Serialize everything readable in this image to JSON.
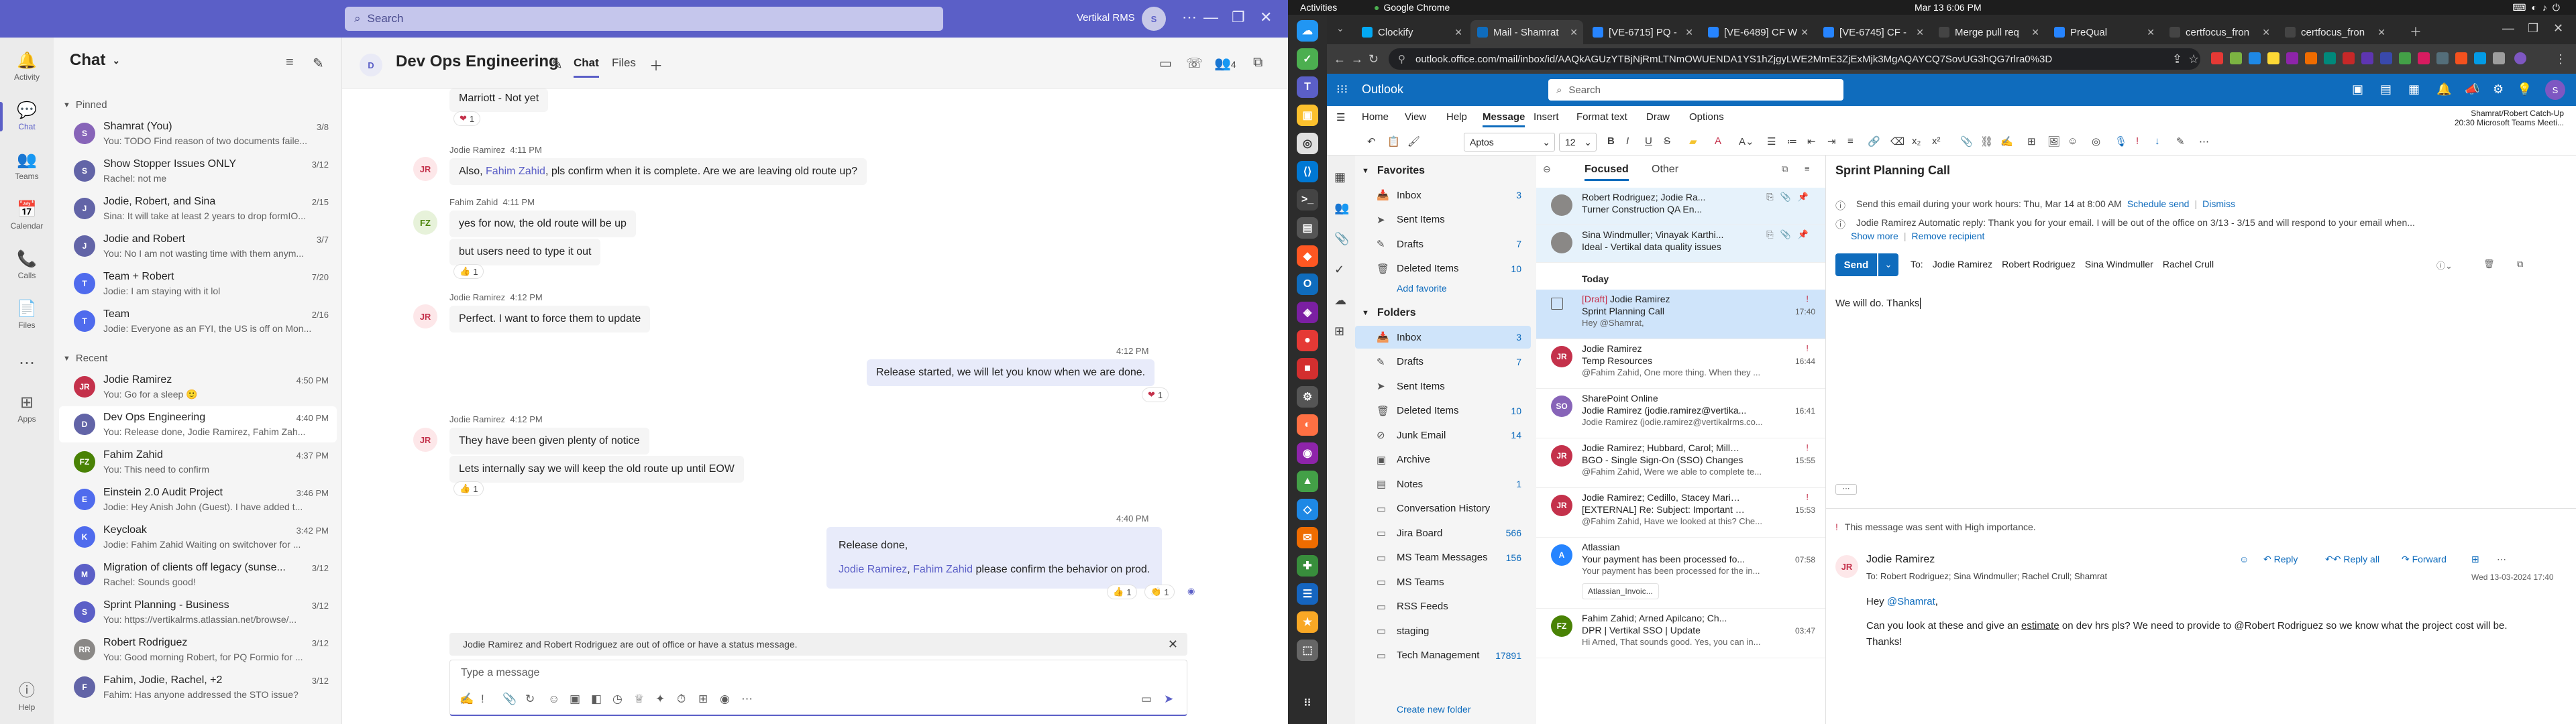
{
  "teams": {
    "search_placeholder": "Search",
    "org_name": "Vertikal RMS",
    "avatar_initials": "S",
    "rail": [
      {
        "label": "Activity",
        "icon": "bell-icon"
      },
      {
        "label": "Chat",
        "icon": "chat-icon"
      },
      {
        "label": "Teams",
        "icon": "teams-icon"
      },
      {
        "label": "Calendar",
        "icon": "calendar-icon"
      },
      {
        "label": "Calls",
        "icon": "phone-icon"
      },
      {
        "label": "Files",
        "icon": "file-icon"
      },
      {
        "label": "Apps",
        "icon": "apps-icon"
      },
      {
        "label": "Help",
        "icon": "help-icon"
      }
    ],
    "list_title": "Chat",
    "pinned_label": "Pinned",
    "recent_label": "Recent",
    "pinned": [
      {
        "name": "Shamrat (You)",
        "preview": "You: TODO Find reason of two documents faile...",
        "date": "3/8",
        "initials": "S",
        "color": "#8764b8"
      },
      {
        "name": "Show Stopper Issues ONLY",
        "preview": "Rachel: not me",
        "date": "3/12",
        "initials": "S",
        "color": "#6264a7"
      },
      {
        "name": "Jodie, Robert, and Sina",
        "preview": "Sina: It will take at least 2 years to drop formIO...",
        "date": "2/15",
        "initials": "J",
        "color": "#6264a7"
      },
      {
        "name": "Jodie and Robert",
        "preview": "You: No I am not wasting time with them anym...",
        "date": "3/7",
        "initials": "J",
        "color": "#6264a7"
      },
      {
        "name": "Team + Robert",
        "preview": "Jodie: I am staying with it lol",
        "date": "7/20",
        "initials": "T",
        "color": "#4f6bed"
      },
      {
        "name": "Team",
        "preview": "Jodie: Everyone as an FYI, the US is off on Mon...",
        "date": "2/16",
        "initials": "T",
        "color": "#4f6bed"
      }
    ],
    "recent": [
      {
        "name": "Jodie Ramirez",
        "preview": "You: Go for a sleep 🙂",
        "date": "4:50 PM",
        "initials": "JR",
        "color": "#c4314b"
      },
      {
        "name": "Dev Ops Engineering",
        "preview": "You: Release done, Jodie Ramirez, Fahim Zah...",
        "date": "4:40 PM",
        "initials": "D",
        "color": "#6264a7"
      },
      {
        "name": "Fahim Zahid",
        "preview": "You: This need to confirm",
        "date": "4:37 PM",
        "initials": "FZ",
        "color": "#498205"
      },
      {
        "name": "Einstein 2.0 Audit Project",
        "preview": "Jodie: Hey Anish John (Guest). I have added t...",
        "date": "3:46 PM",
        "initials": "E",
        "color": "#4f6bed"
      },
      {
        "name": "Keycloak",
        "preview": "Jodie: Fahim Zahid Waiting on switchover for ...",
        "date": "3:42 PM",
        "initials": "K",
        "color": "#4f6bed"
      },
      {
        "name": "Migration of clients off legacy (sunse...",
        "preview": "Rachel: Sounds good!",
        "date": "3/12",
        "initials": "M",
        "color": "#5b5fc7"
      },
      {
        "name": "Sprint Planning - Business",
        "preview": "You: https://vertikalrms.atlassian.net/browse/...",
        "date": "3/12",
        "initials": "S",
        "color": "#5b5fc7"
      },
      {
        "name": "Robert Rodriguez",
        "preview": "You: Good morning Robert, for PQ Formio for ...",
        "date": "3/12",
        "initials": "RR",
        "color": "#8a8886"
      },
      {
        "name": "Fahim, Jodie, Rachel, +2",
        "preview": "Fahim: Has anyone addressed the STO issue?",
        "date": "3/12",
        "initials": "F",
        "color": "#6264a7"
      }
    ],
    "chat": {
      "title": "Dev Ops Engineering",
      "tab_chat": "Chat",
      "tab_files": "Files",
      "participants": "4",
      "messages": [
        {
          "text": "Marriott - Not yet",
          "reaction": "1"
        },
        {
          "author": "Jodie Ramirez",
          "time": "4:11 PM",
          "text_before": "Also, ",
          "mention": "Fahim Zahid",
          "text_after": ", pls confirm when it is complete.  Are we are leaving old route up?"
        },
        {
          "author": "Fahim Zahid",
          "time": "4:11 PM",
          "text1": "yes for now, the old route will be up",
          "text2": "but users need to type it out",
          "reaction": "1"
        },
        {
          "author": "Jodie Ramirez",
          "time": "4:12 PM",
          "text": "Perfect.  I want to force them to update"
        },
        {
          "me_time": "4:12 PM",
          "text": "Release started, we will let you know when we are done.",
          "reaction": "1"
        },
        {
          "author": "Jodie Ramirez",
          "time": "4:12 PM",
          "text1": "They have been given plenty of notice",
          "text2": "Lets internally say we will keep the old route up until EOW",
          "reaction": "1"
        },
        {
          "me_time": "4:40 PM",
          "line1": "Release done,",
          "mention1": "Jodie Ramirez",
          "sep": ", ",
          "mention2": "Fahim Zahid",
          "line2_after": " please confirm the behavior on prod.",
          "reaction_a": "1",
          "reaction_b": "1"
        }
      ],
      "ooo_notice": "Jodie Ramirez and Robert Rodriguez are out of office or have a status message.",
      "compose_placeholder": "Type a message"
    }
  },
  "os": {
    "activities": "Activities",
    "app_name": "Google Chrome",
    "clock": "Mar 13  6:06 PM"
  },
  "chrome": {
    "tabs": [
      {
        "title": "Clockify",
        "color": "#03a9f4"
      },
      {
        "title": "Mail - Shamrat",
        "color": "#0f6cbd",
        "active": true
      },
      {
        "title": "[VE-6715] PQ -",
        "color": "#2684ff"
      },
      {
        "title": "[VE-6489] CF W",
        "color": "#2684ff"
      },
      {
        "title": "[VE-6745] CF -",
        "color": "#2684ff"
      },
      {
        "title": "Merge pull req",
        "color": "#444"
      },
      {
        "title": "PreQual",
        "color": "#2684ff"
      },
      {
        "title": "certfocus_fron",
        "color": "#444"
      },
      {
        "title": "certfocus_fron",
        "color": "#444"
      }
    ],
    "url": "outlook.office.com/mail/inbox/id/AAQkAGUzYTBjNjRmLTNmOWUENDA1YS1hZjgyLWE2MmE3ZjExMjk3MgAQAYCQ7SovUG3hQG7rlra0%3D"
  },
  "outlook": {
    "brand": "Outlook",
    "search_placeholder": "Search",
    "avatar": "S",
    "ribbon_tabs": [
      "Home",
      "View",
      "Help",
      "Message",
      "Insert",
      "Format text",
      "Draw",
      "Options"
    ],
    "meeting": {
      "title": "Shamrat/Robert Catch-Up",
      "sub": "20:30 Microsoft Teams Meeti..."
    },
    "font_name": "Aptos",
    "font_size": "12",
    "favorites_label": "Favorites",
    "favorites": [
      {
        "name": "Inbox",
        "count": "3",
        "icon": "inbox-icon"
      },
      {
        "name": "Sent Items",
        "count": "",
        "icon": "send-icon"
      },
      {
        "name": "Drafts",
        "count": "7",
        "icon": "draft-icon"
      },
      {
        "name": "Deleted Items",
        "count": "10",
        "icon": "trash-icon"
      }
    ],
    "add_favorite": "Add favorite",
    "folders_label": "Folders",
    "folders": [
      {
        "name": "Inbox",
        "count": "3",
        "icon": "inbox-icon",
        "selected": true
      },
      {
        "name": "Drafts",
        "count": "7",
        "icon": "draft-icon"
      },
      {
        "name": "Sent Items",
        "count": "",
        "icon": "send-icon"
      },
      {
        "name": "Deleted Items",
        "count": "10",
        "icon": "trash-icon"
      },
      {
        "name": "Junk Email",
        "count": "14",
        "icon": "junk-icon"
      },
      {
        "name": "Archive",
        "count": "",
        "icon": "archive-icon"
      },
      {
        "name": "Notes",
        "count": "1",
        "icon": "note-icon"
      },
      {
        "name": "Conversation History",
        "count": "",
        "icon": "folder-icon"
      },
      {
        "name": "Jira Board",
        "count": "566",
        "icon": "folder-icon"
      },
      {
        "name": "MS Team Messages",
        "count": "156",
        "icon": "folder-icon"
      },
      {
        "name": "MS Teams",
        "count": "",
        "icon": "folder-icon"
      },
      {
        "name": "RSS Feeds",
        "count": "",
        "icon": "folder-icon"
      },
      {
        "name": "staging",
        "count": "",
        "icon": "folder-icon"
      },
      {
        "name": "Tech Management",
        "count": "17891",
        "icon": "folder-icon"
      }
    ],
    "create_folder": "Create new folder",
    "list_tabs": [
      "Focused",
      "Other"
    ],
    "today_label": "Today",
    "pinned_mails": [
      {
        "sender": "Robert Rodriguez; Jodie Ra...",
        "subject": "Turner Construction QA En...",
        "preview": ""
      },
      {
        "sender": "Sina Windmuller; Vinayak Karthi...",
        "subject": "Ideal - Vertikal data quality issues",
        "preview": ""
      }
    ],
    "mails": [
      {
        "draft": "[Draft]",
        "sender": "Jodie Ramirez",
        "subject": "Sprint Planning Call",
        "preview": "Hey @Shamrat,",
        "time": "17:40",
        "selected": true
      },
      {
        "sender": "Jodie Ramirez",
        "subject": "Temp Resources",
        "preview": "@Fahim Zahid, One more thing. When they ...",
        "time": "16:44",
        "initials": "JR",
        "color": "#c4314b"
      },
      {
        "sender": "SharePoint Online",
        "subject": "Jodie Ramirez (jodie.ramirez@vertika...",
        "preview": "Jodie Ramirez (jodie.ramirez@vertikalrms.co...",
        "time": "16:41",
        "initials": "SO",
        "color": "#8764b8"
      },
      {
        "sender": "Jodie Ramirez; Hubbard, Carol; Millar, ...",
        "subject": "BGO - Single Sign-On (SSO) Changes",
        "preview": "@Fahim Zahid, Were we able to complete te...",
        "time": "15:55",
        "initials": "JR",
        "color": "#c4314b"
      },
      {
        "sender": "Jodie Ramirez; Cedillo, Stacey Marie; S...",
        "subject": "[EXTERNAL] Re: Subject: Important N...",
        "preview": "@Fahim Zahid, Have we looked at this? Che...",
        "time": "15:53",
        "initials": "JR",
        "color": "#c4314b"
      },
      {
        "sender": "Atlassian",
        "subject": "Your payment has been processed fo...",
        "preview": "Your payment has been processed for the in...",
        "time": "07:58",
        "initials": "A",
        "color": "#2684ff",
        "attachment": "Atlassian_Invoic..."
      },
      {
        "sender": "Fahim Zahid; Arned Apilcano; Ch...",
        "subject": "DPR | Vertikal SSO | Update",
        "preview": "Hi Arned, That sounds good. Yes, you can in...",
        "time": "03:47",
        "initials": "FZ",
        "color": "#498205"
      }
    ],
    "read": {
      "subject": "Sprint Planning Call",
      "schedule_note": "Send this email during your work hours: Thu, Mar 14 at 8:00 AM",
      "schedule_send": "Schedule send",
      "dismiss": "Dismiss",
      "auto_reply": "Jodie Ramirez Automatic reply: Thank you for your email. I will be out of the office on 3/13 - 3/15 and will respond to your email when...",
      "show_more": "Show more",
      "remove_recipient": "Remove recipient",
      "send": "Send",
      "to_label": "To:",
      "recipients": [
        "Jodie Ramirez",
        "Robert Rodriguez",
        "Sina Windmuller",
        "Rachel Crull"
      ],
      "body": "We will do. Thanks",
      "importance": "This message was sent with High importance.",
      "q_from": "Jodie Ramirez",
      "q_to": "To:  Robert Rodriguez;   Sina Windmuller;   Rachel Crull;   Shamrat",
      "q_date": "Wed 13-03-2024 17:40",
      "q_actions": [
        "Reply",
        "Reply all",
        "Forward"
      ],
      "q_greeting_pre": "Hey ",
      "q_greeting_mention": "@Shamrat",
      "q_greeting_post": ",",
      "q_line_pre": "Can you look at these and give an ",
      "q_line_link": "estimate",
      "q_line_post": " on dev hrs pls?  We need to provide to @Robert Rodriguez so we know what the project cost will be.  Thanks!"
    }
  }
}
